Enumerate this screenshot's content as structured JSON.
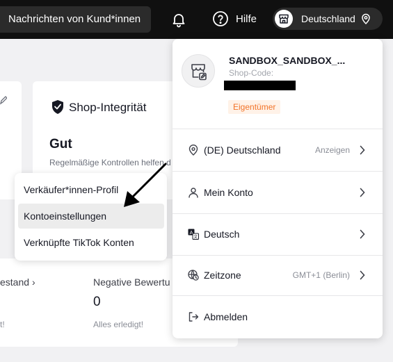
{
  "topbar": {
    "search_text": "Nachrichten von Kund*innen",
    "help_label": "Hilfe",
    "region_label": "Deutschland"
  },
  "background": {
    "integrity_title": "Shop-Integrität",
    "integrity_status": "Gut",
    "integrity_desc": "Regelmäßige Kontrollen helfen d",
    "stat1_label": "estand",
    "stat1_sub": "t!",
    "stat2_label": "Negative Bewertu",
    "stat2_value": "0",
    "stat2_sub": "Alles erledigt!"
  },
  "submenu": {
    "items": [
      {
        "label": "Verkäufer*innen-Profil",
        "active": false
      },
      {
        "label": "Kontoeinstellungen",
        "active": true
      },
      {
        "label": "Verknüpfte TikTok Konten",
        "active": false
      }
    ]
  },
  "account_menu": {
    "shop_name": "SANDBOX_SANDBOX_...",
    "shop_code_label": "Shop-Code:",
    "owner_badge": "Eigentümer",
    "rows": [
      {
        "icon": "location-pin-icon",
        "label": "(DE) Deutschland",
        "meta": "Anzeigen"
      },
      {
        "icon": "person-icon",
        "label": "Mein Konto",
        "meta": ""
      },
      {
        "icon": "translate-icon",
        "label": "Deutsch",
        "meta": ""
      },
      {
        "icon": "globe-clock-icon",
        "label": "Zeitzone",
        "meta": "GMT+1 (Berlin)"
      },
      {
        "icon": "logout-icon",
        "label": "Abmelden",
        "meta": ""
      }
    ]
  },
  "colors": {
    "topbar_bg": "#101010",
    "owner_badge_text": "#f27329",
    "owner_badge_bg": "#fff2e8"
  }
}
